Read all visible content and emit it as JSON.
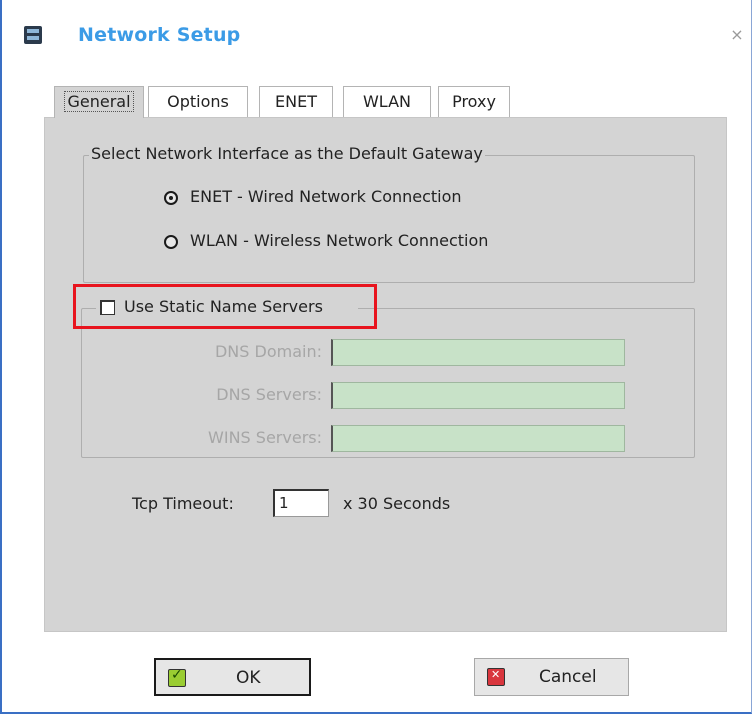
{
  "window": {
    "title": "Network Setup",
    "close_symbol": "×"
  },
  "tabs": [
    {
      "label": "General",
      "active": true
    },
    {
      "label": "Options",
      "active": false
    },
    {
      "label": "ENET",
      "active": false
    },
    {
      "label": "WLAN",
      "active": false
    },
    {
      "label": "Proxy",
      "active": false
    }
  ],
  "gateway_group": {
    "label": "Select Network Interface as the Default Gateway",
    "options": [
      {
        "label": "ENET - Wired Network Connection",
        "checked": true
      },
      {
        "label": "WLAN - Wireless Network Connection",
        "checked": false
      }
    ]
  },
  "name_servers_group": {
    "checkbox_label": "Use Static Name Servers",
    "checked": false,
    "fields": [
      {
        "label": "DNS Domain:",
        "value": ""
      },
      {
        "label": "DNS Servers:",
        "value": ""
      },
      {
        "label": "WINS Servers:",
        "value": ""
      }
    ]
  },
  "tcp_timeout": {
    "label": "Tcp Timeout:",
    "value": "1",
    "suffix": "x 30 Seconds"
  },
  "buttons": {
    "ok_label": "OK",
    "cancel_label": "Cancel"
  },
  "icons": {
    "app": "network-setup-icon",
    "close": "close-icon",
    "ok": "check-icon",
    "cancel": "cancel-icon"
  },
  "colors": {
    "title": "#3b9be6",
    "highlight": "#e8141e",
    "field_disabled": "#c8e2c8",
    "panel": "#d4d4d4"
  }
}
